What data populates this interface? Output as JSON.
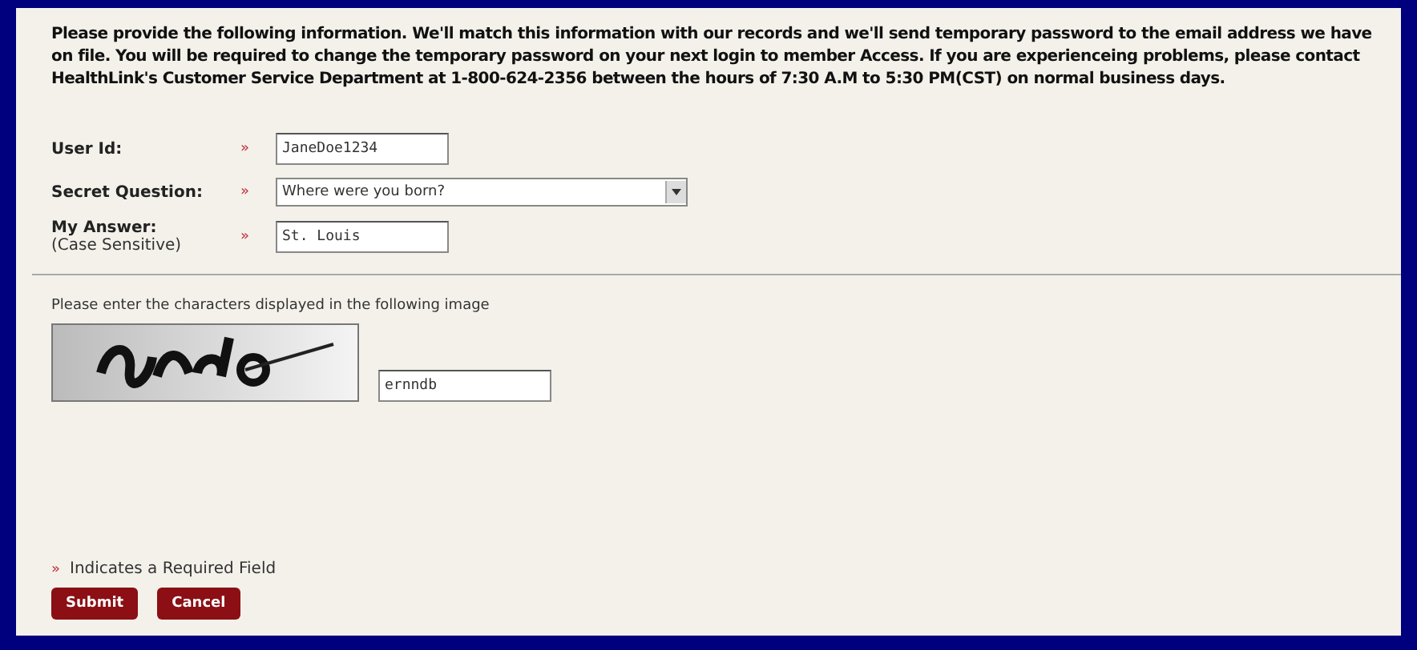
{
  "intro": "Please provide the following information. We'll match this information with our records and we'll send temporary password to the email address we have on file. You will be required to change the temporary password on your next login to member Access. If you are experienceing problems, please contact HealthLink's Customer Service Department at 1-800-624-2356 between the hours of 7:30 A.M to 5:30 PM(CST) on normal business days.",
  "fields": [
    {
      "kind": "text",
      "label": "User Id:",
      "required_mark": "»",
      "value": "JaneDoe1234"
    },
    {
      "kind": "select",
      "label": "Secret Question:",
      "required_mark": "»",
      "value": "Where were you born?"
    },
    {
      "kind": "text",
      "label": "My Answer:",
      "note": "(Case Sensitive)",
      "required_mark": "»",
      "value": "St. Louis"
    }
  ],
  "captcha": {
    "instruction": "Please enter the characters displayed in the following image",
    "value": "ernndb"
  },
  "legend": {
    "mark": "»",
    "text": "Indicates a Required Field"
  },
  "buttons": [
    "Submit",
    "Cancel"
  ]
}
